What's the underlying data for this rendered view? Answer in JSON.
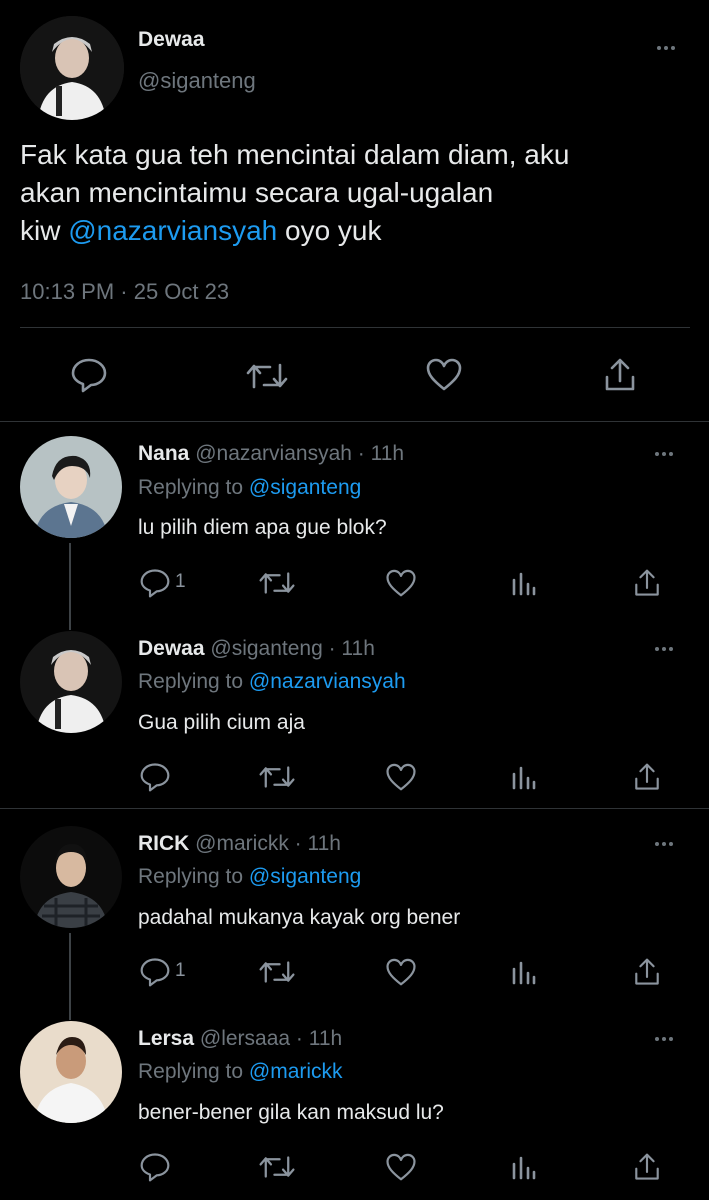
{
  "main_tweet": {
    "display_name": "Dewaa",
    "handle": "@siganteng",
    "text_line1": "Fak kata gua teh mencintai dalam diam, aku",
    "text_line2": "akan mencintaimu secara ugal-ugalan",
    "text_line3_pre": "kiw ",
    "mention": "@nazarviansyah",
    "text_line3_post": " oyo yuk",
    "timestamp": "10:13 PM · 25 Oct 23"
  },
  "replies": [
    {
      "display_name": "Nana",
      "meta": " @nazarviansyah · 11h",
      "replying_label": "Replying to ",
      "replying_to": "@siganteng",
      "text": "lu pilih diem apa gue blok?",
      "reply_count": "1"
    },
    {
      "display_name": "Dewaa",
      "meta": " @siganteng · 11h",
      "replying_label": "Replying to ",
      "replying_to": "@nazarviansyah",
      "text": "Gua pilih cium aja",
      "reply_count": ""
    },
    {
      "display_name": "RICK",
      "meta": " @marickk · 11h",
      "replying_label": "Replying to ",
      "replying_to": "@siganteng",
      "text": "padahal mukanya kayak org bener",
      "reply_count": "1"
    },
    {
      "display_name": "Lersa",
      "meta": " @lersaaa · 11h",
      "replying_label": "Replying to ",
      "replying_to": "@marickk",
      "text": "bener-bener gila kan maksud lu?",
      "reply_count": ""
    }
  ],
  "colors": {
    "background": "#000000",
    "link": "#1d9bf0",
    "muted": "#6e767d",
    "text": "#e7e9ea"
  },
  "icons": [
    "reply-icon",
    "retweet-icon",
    "like-icon",
    "views-icon",
    "share-icon",
    "more-icon"
  ]
}
